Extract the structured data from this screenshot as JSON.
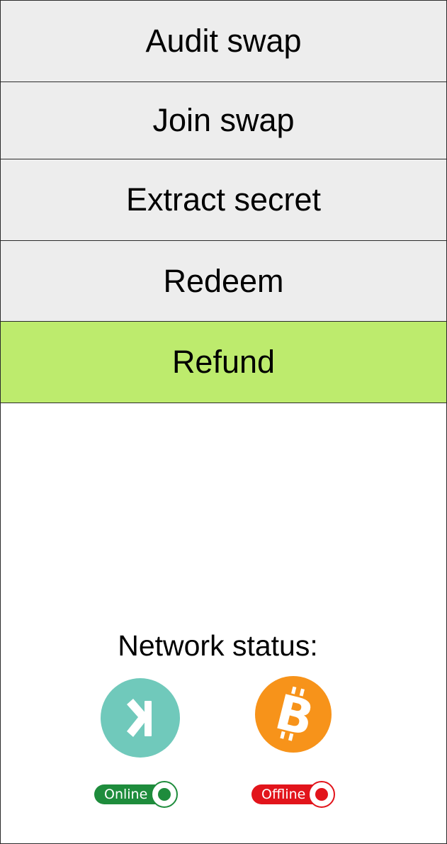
{
  "menu": {
    "items": [
      {
        "label": "Audit swap"
      },
      {
        "label": "Join swap"
      },
      {
        "label": "Extract secret"
      },
      {
        "label": "Redeem"
      },
      {
        "label": "Refund"
      }
    ],
    "active_color": "#bdeb6d",
    "default_color": "#ededed"
  },
  "network": {
    "title": "Network status:",
    "kaspa": {
      "icon": "kaspa-logo-icon",
      "color": "#70c9bb",
      "status_label": "Online",
      "status_color": "#1e8c3c"
    },
    "bitcoin": {
      "icon": "bitcoin-logo-icon",
      "color": "#f7931a",
      "status_label": "Offline",
      "status_color": "#e2141b"
    }
  }
}
